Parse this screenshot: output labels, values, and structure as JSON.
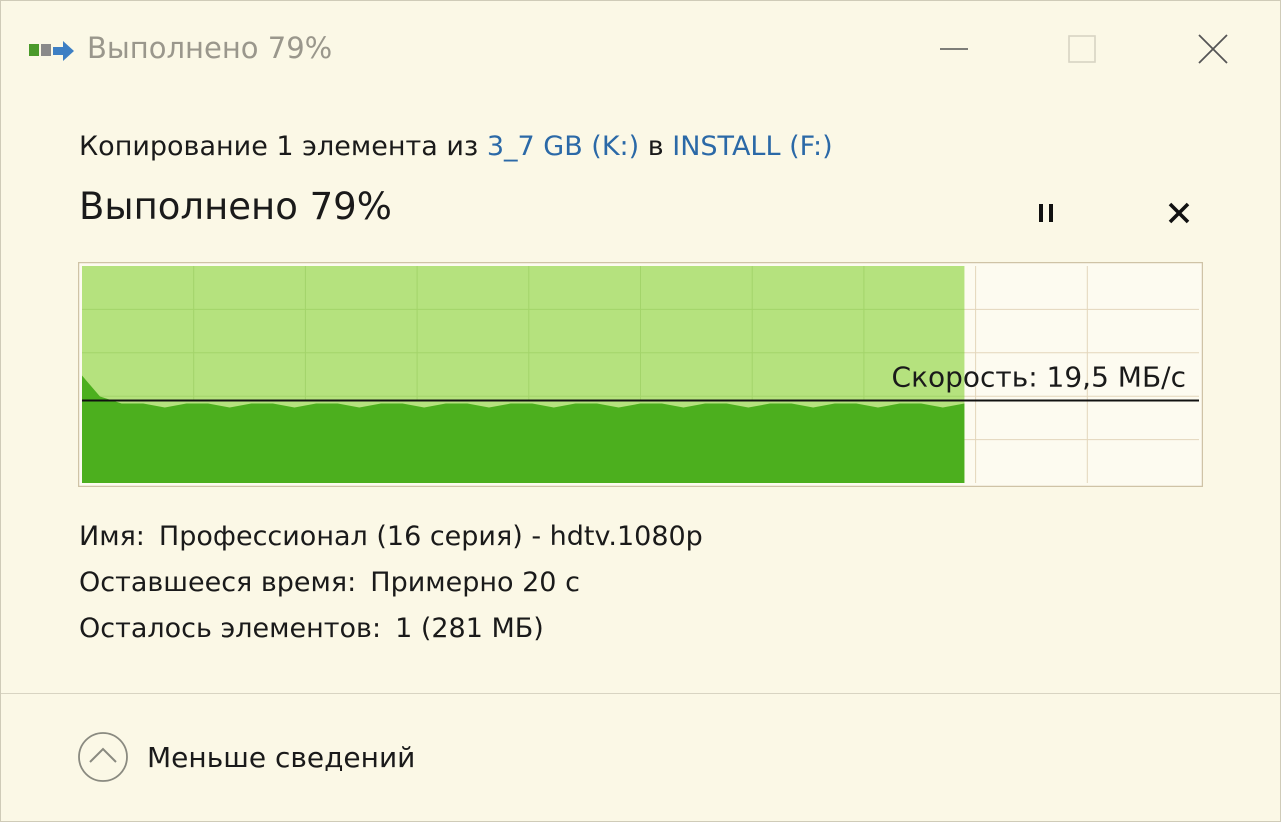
{
  "window": {
    "title": "Выполнено 79%",
    "icon": "copy-files-icon",
    "controls": [
      "minimize-icon",
      "maximize-icon",
      "close-icon"
    ]
  },
  "operation": {
    "prefix": "Копирование 1 элемента из ",
    "source": "3_7 GB (K:)",
    "middle": " в ",
    "destination": "INSTALL (F:)"
  },
  "progress": {
    "headline": "Выполнено 79%",
    "percent": 79,
    "speed_label": "Скорость: 19,5 МБ/с",
    "speed_level_fraction": 0.38
  },
  "actions": {
    "pause_icon": "pause-icon",
    "cancel_icon": "cancel-icon"
  },
  "details": {
    "name_label": "Имя:",
    "name_value": "Профессионал (16 серия) - hdtv.1080p",
    "time_label": "Оставшееся время:",
    "time_value": "Примерно 20 с",
    "items_label": "Осталось элементов:",
    "items_value": "1 (281 МБ)"
  },
  "footer": {
    "toggle_label": "Меньше сведений",
    "toggle_icon": "chevron-up-circle-icon"
  },
  "colors": {
    "background": "#fbf8e6",
    "progress_light": "#b5e27e",
    "progress_dark": "#4caf1e",
    "grid": "#d9c8a8",
    "link": "#2b69a7"
  }
}
